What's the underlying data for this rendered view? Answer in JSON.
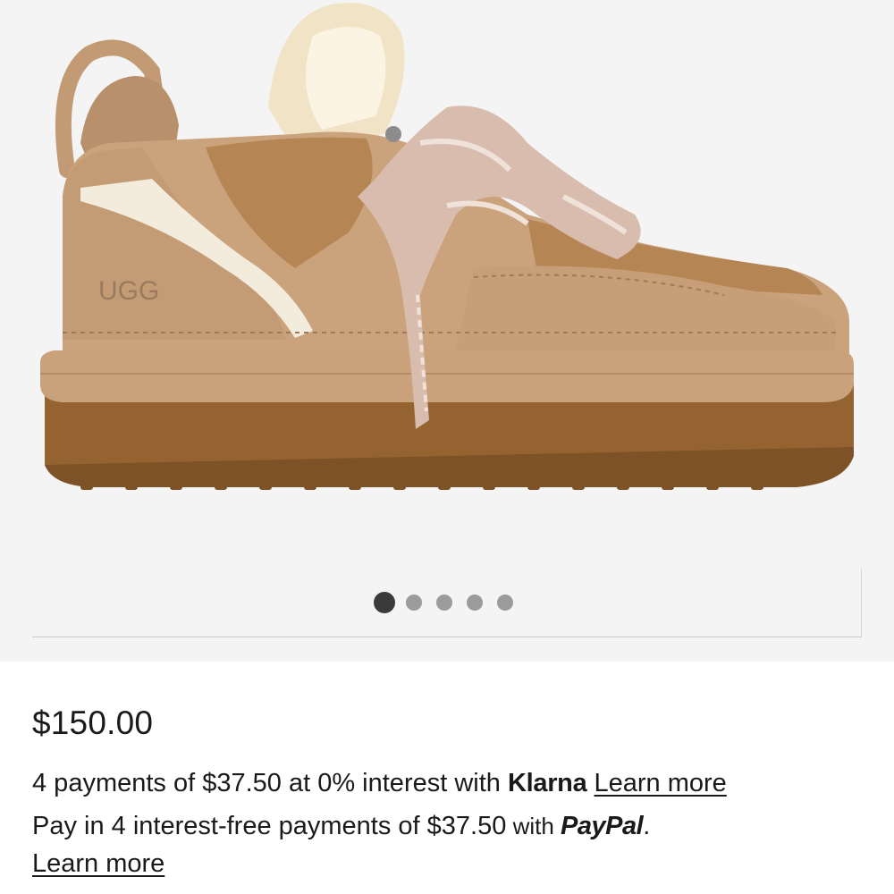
{
  "product": {
    "image_alt": "UGG lace-up suede platform sneaker with shearling collar",
    "logo_text": "UGG",
    "carousel": {
      "total_slides": 5,
      "active_index": 0
    }
  },
  "pricing": {
    "price": "$150.00",
    "klarna": {
      "text": "4 payments of $37.50 at 0% interest with ",
      "brand": "Klarna",
      "learn_more": "Learn more"
    },
    "paypal": {
      "text_before": "Pay in 4 interest-free payments of $37.50",
      "text_with": " with ",
      "brand": "PayPal",
      "period": ".",
      "learn_more": "Learn more"
    }
  },
  "colors": {
    "gallery_bg": "#f4f4f4",
    "dot_active": "#3a3a3a",
    "dot_inactive": "#9b9b9b",
    "text": "#1a1a1a"
  }
}
